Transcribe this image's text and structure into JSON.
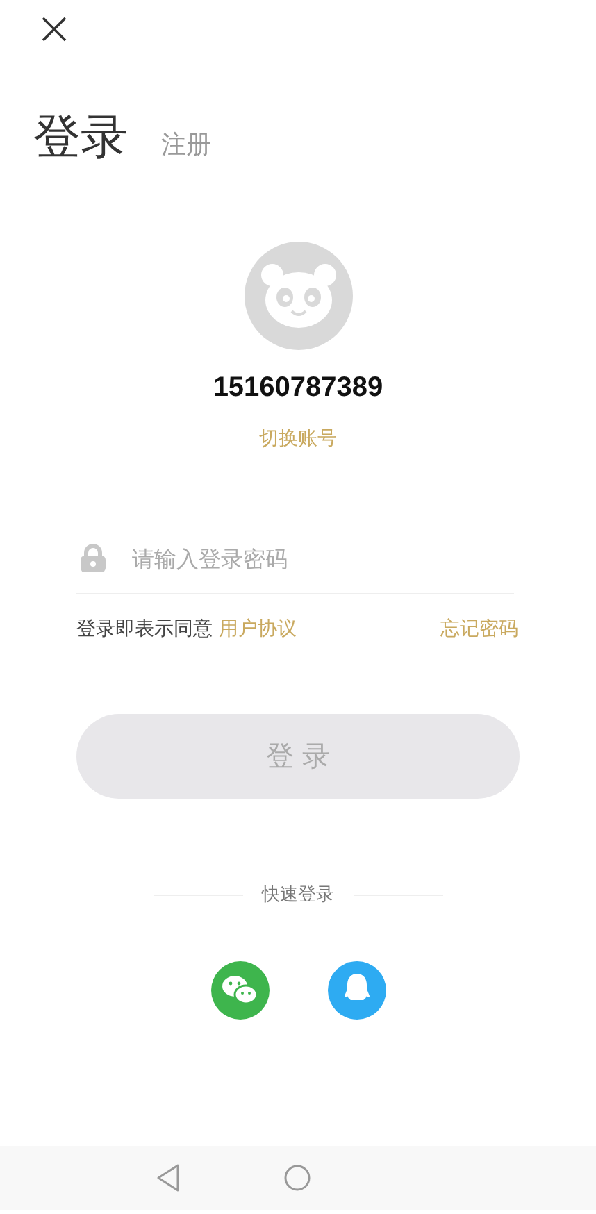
{
  "tabs": [
    {
      "label": "登录",
      "selected": true
    },
    {
      "label": "注册",
      "selected": false
    }
  ],
  "account": {
    "phone": "15160787389",
    "switch_link": "切换账号"
  },
  "password_field": {
    "placeholder": "请输入登录密码"
  },
  "agreement": {
    "text": "登录即表示同意",
    "link": "用户协议"
  },
  "forgot_link": "忘记密码",
  "login_button": {
    "label": "登 录",
    "disabled": true
  },
  "quick_login": {
    "label": "快速登录",
    "providers": [
      {
        "kind": "wechat"
      },
      {
        "kind": "qq"
      }
    ]
  }
}
